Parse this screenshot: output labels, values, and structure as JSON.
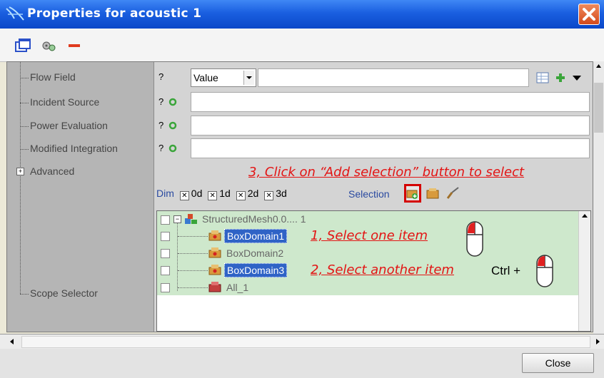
{
  "window": {
    "title": "Properties for acoustic 1"
  },
  "toolbar": {
    "icons": [
      "windows-icon",
      "settings-icon",
      "remove-icon"
    ]
  },
  "properties": [
    {
      "label": "Flow Field",
      "q": "?",
      "has_select": true
    },
    {
      "label": "Incident Source",
      "q": "?"
    },
    {
      "label": "Power Evaluation",
      "q": "?"
    },
    {
      "label": "Modified Integration",
      "q": "?"
    },
    {
      "label": "Advanced",
      "expander": "+"
    },
    {
      "label": "Scope Selector"
    }
  ],
  "flow_field": {
    "select_value": "Value"
  },
  "instructions": {
    "step3": "3, Click on “Add selection” button to select",
    "step1": "1, Select one item",
    "step2": "2, Select another item",
    "ctrl": "Ctrl +"
  },
  "scope": {
    "dim_label": "Dim",
    "dims": [
      "0d",
      "1d",
      "2d",
      "3d"
    ],
    "selection_label": "Selection"
  },
  "tree": {
    "root": "StructuredMesh0.0.... 1",
    "items": [
      "BoxDomain1",
      "BoxDomain2",
      "BoxDomain3",
      "All_1"
    ]
  },
  "footer": {
    "close_label": "Close"
  }
}
